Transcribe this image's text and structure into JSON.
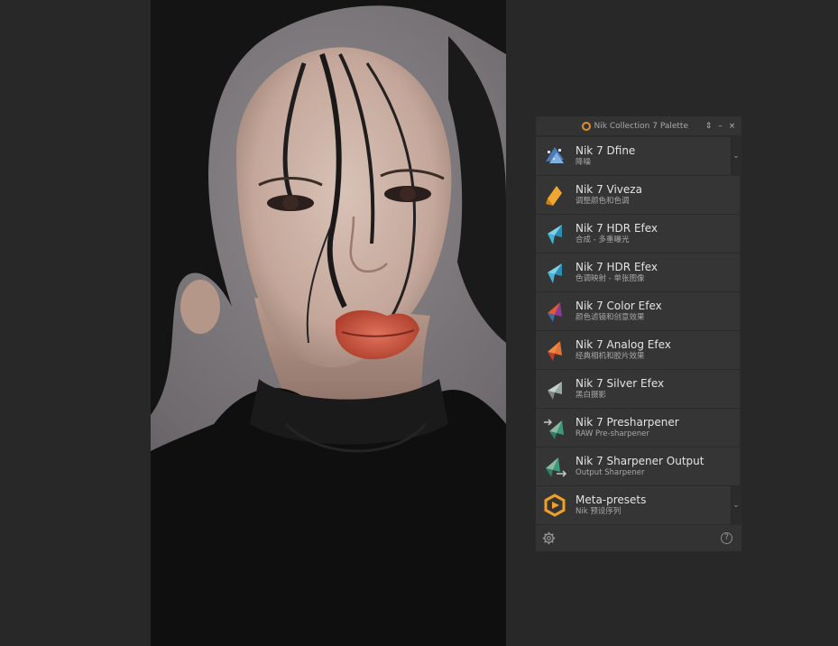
{
  "palette": {
    "title": "Nik Collection 7 Palette",
    "controls": {
      "move": "⇕",
      "minimize": "–",
      "close": "×"
    },
    "items": [
      {
        "name": "Nik 7 Dfine",
        "sub": "降噪",
        "icon": "dfine-icon",
        "expandable": true
      },
      {
        "name": "Nik 7 Viveza",
        "sub": "调整颜色和色调",
        "icon": "viveza-icon"
      },
      {
        "name": "Nik 7 HDR Efex",
        "sub": "合成 - 多重曝光",
        "icon": "hdr-efex-icon"
      },
      {
        "name": "Nik 7 HDR Efex",
        "sub": "色调映射 - 单张图像",
        "icon": "hdr-efex-icon"
      },
      {
        "name": "Nik 7 Color Efex",
        "sub": "颜色滤镜和创意效果",
        "icon": "color-efex-icon"
      },
      {
        "name": "Nik 7 Analog Efex",
        "sub": "经典相机和胶片效果",
        "icon": "analog-efex-icon"
      },
      {
        "name": "Nik 7 Silver Efex",
        "sub": "黑白摄影",
        "icon": "silver-efex-icon"
      },
      {
        "name": "Nik 7 Presharpener",
        "sub": "RAW Pre-sharpener",
        "icon": "presharpener-icon"
      },
      {
        "name": "Nik 7 Sharpener Output",
        "sub": "Output Sharpener",
        "icon": "sharpener-output-icon"
      },
      {
        "name": "Meta-presets",
        "sub": "Nik 预设序列",
        "icon": "meta-presets-icon",
        "expandable": true
      }
    ],
    "footer": {
      "help": "?"
    }
  },
  "colors": {
    "viveza": "#f0a630",
    "hdr": "#3fb6d8",
    "color_efex_red": "#d4473a",
    "analog_orange": "#e5703a",
    "silver": "#9aa6a0",
    "sharpener": "#3a9a7a",
    "meta": "#f0a028"
  }
}
